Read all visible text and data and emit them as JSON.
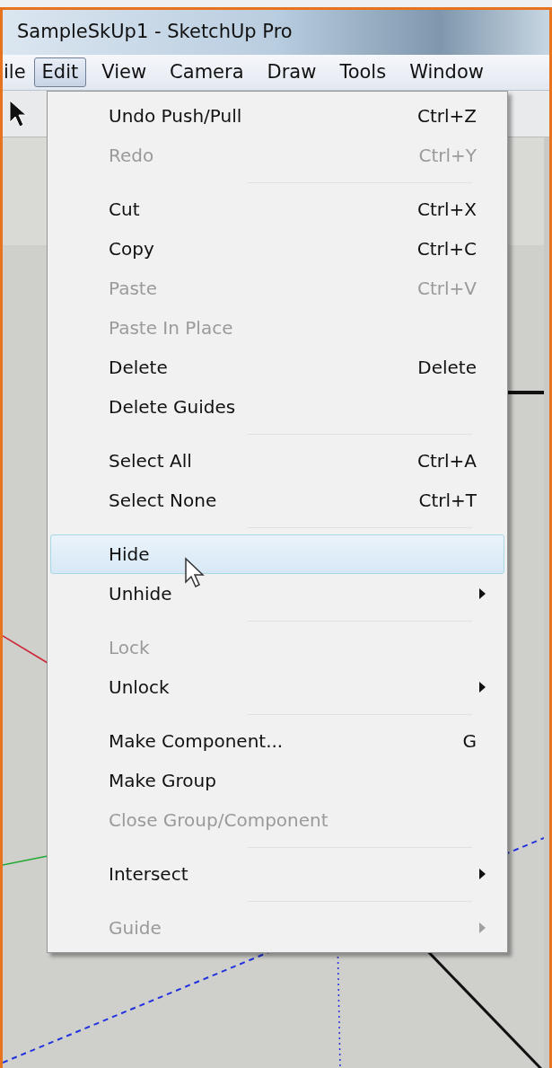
{
  "window": {
    "title": "SampleSkUp1 - SketchUp Pro"
  },
  "menubar": [
    {
      "label": "ile",
      "selected": false
    },
    {
      "label": "Edit",
      "selected": true
    },
    {
      "label": "View",
      "selected": false
    },
    {
      "label": "Camera",
      "selected": false
    },
    {
      "label": "Draw",
      "selected": false
    },
    {
      "label": "Tools",
      "selected": false
    },
    {
      "label": "Window",
      "selected": false
    }
  ],
  "menu": [
    {
      "kind": "item",
      "label": "Undo Push/Pull",
      "shortcut": "Ctrl+Z",
      "disabled": false,
      "selected": false,
      "submenu": false
    },
    {
      "kind": "item",
      "label": "Redo",
      "shortcut": "Ctrl+Y",
      "disabled": true,
      "selected": false,
      "submenu": false
    },
    {
      "kind": "separator"
    },
    {
      "kind": "item",
      "label": "Cut",
      "shortcut": "Ctrl+X",
      "disabled": false,
      "selected": false,
      "submenu": false
    },
    {
      "kind": "item",
      "label": "Copy",
      "shortcut": "Ctrl+C",
      "disabled": false,
      "selected": false,
      "submenu": false
    },
    {
      "kind": "item",
      "label": "Paste",
      "shortcut": "Ctrl+V",
      "disabled": true,
      "selected": false,
      "submenu": false
    },
    {
      "kind": "item",
      "label": "Paste In Place",
      "disabled": true,
      "selected": false,
      "submenu": false
    },
    {
      "kind": "item",
      "label": "Delete",
      "shortcut": "Delete",
      "disabled": false,
      "selected": false,
      "submenu": false
    },
    {
      "kind": "item",
      "label": "Delete Guides",
      "disabled": false,
      "selected": false,
      "submenu": false
    },
    {
      "kind": "separator"
    },
    {
      "kind": "item",
      "label": "Select All",
      "shortcut": "Ctrl+A",
      "disabled": false,
      "selected": false,
      "submenu": false
    },
    {
      "kind": "item",
      "label": "Select None",
      "shortcut": "Ctrl+T",
      "disabled": false,
      "selected": false,
      "submenu": false
    },
    {
      "kind": "separator"
    },
    {
      "kind": "item",
      "label": "Hide",
      "disabled": false,
      "selected": true,
      "submenu": false
    },
    {
      "kind": "item",
      "label": "Unhide",
      "disabled": false,
      "selected": false,
      "submenu": true
    },
    {
      "kind": "separator"
    },
    {
      "kind": "item",
      "label": "Lock",
      "disabled": true,
      "selected": false,
      "submenu": false
    },
    {
      "kind": "item",
      "label": "Unlock",
      "disabled": false,
      "selected": false,
      "submenu": true
    },
    {
      "kind": "separator"
    },
    {
      "kind": "item",
      "label": "Make Component...",
      "shortcut": "G",
      "disabled": false,
      "selected": false,
      "submenu": false
    },
    {
      "kind": "item",
      "label": "Make Group",
      "disabled": false,
      "selected": false,
      "submenu": false
    },
    {
      "kind": "item",
      "label": "Close Group/Component",
      "disabled": true,
      "selected": false,
      "submenu": false
    },
    {
      "kind": "separator"
    },
    {
      "kind": "item",
      "label": "Intersect",
      "disabled": false,
      "selected": false,
      "submenu": true
    },
    {
      "kind": "separator"
    },
    {
      "kind": "item",
      "label": "Guide",
      "disabled": true,
      "selected": false,
      "submenu": true
    }
  ]
}
